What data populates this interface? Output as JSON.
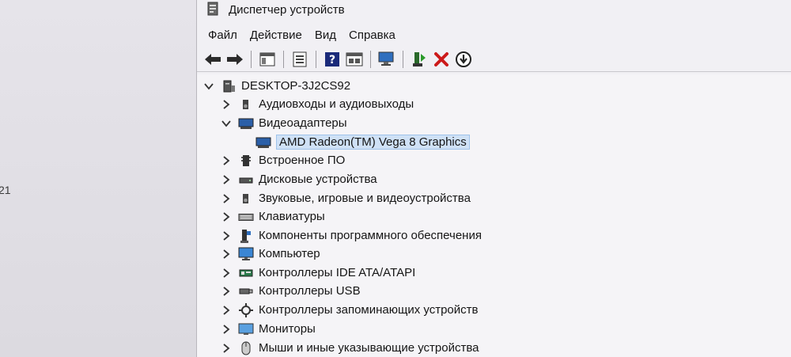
{
  "background_window": {
    "partial_text": "21"
  },
  "window": {
    "title": "Диспетчер устройств"
  },
  "menu": [
    {
      "label": "Файл"
    },
    {
      "label": "Действие"
    },
    {
      "label": "Вид"
    },
    {
      "label": "Справка"
    }
  ],
  "toolbar": {
    "icons": [
      "back-arrow-icon",
      "forward-arrow-icon",
      "show-hide-tree-icon",
      "properties-icon",
      "help-icon",
      "view-icon",
      "scan-hardware-icon",
      "update-driver-icon",
      "uninstall-icon",
      "disable-icon"
    ]
  },
  "tree": {
    "root": {
      "label": "DESKTOP-3J2CS92",
      "expanded": true
    },
    "items": [
      {
        "label": "Аудиовходы и аудиовыходы",
        "icon": "speaker-icon",
        "expanded": false
      },
      {
        "label": "Видеоадаптеры",
        "icon": "display-adapter-icon",
        "expanded": true
      },
      {
        "label": "AMD Radeon(TM) Vega 8 Graphics",
        "icon": "display-adapter-icon",
        "child": true,
        "selected": true
      },
      {
        "label": "Встроенное ПО",
        "icon": "firmware-icon",
        "expanded": false
      },
      {
        "label": "Дисковые устройства",
        "icon": "disk-drive-icon",
        "expanded": false
      },
      {
        "label": "Звуковые, игровые и видеоустройства",
        "icon": "speaker-icon",
        "expanded": false
      },
      {
        "label": "Клавиатуры",
        "icon": "keyboard-icon",
        "expanded": false
      },
      {
        "label": "Компоненты программного обеспечения",
        "icon": "software-component-icon",
        "expanded": false
      },
      {
        "label": "Компьютер",
        "icon": "computer-icon",
        "expanded": false
      },
      {
        "label": "Контроллеры IDE ATA/ATAPI",
        "icon": "ide-controller-icon",
        "expanded": false
      },
      {
        "label": "Контроллеры USB",
        "icon": "usb-icon",
        "expanded": false
      },
      {
        "label": "Контроллеры запоминающих устройств",
        "icon": "storage-controller-icon",
        "expanded": false
      },
      {
        "label": "Мониторы",
        "icon": "monitor-icon",
        "expanded": false
      },
      {
        "label": "Мыши и иные указывающие устройства",
        "icon": "mouse-icon",
        "expanded": false
      }
    ]
  },
  "colors": {
    "selection_bg": "#cfe1f6",
    "uninstall_red": "#cc1a1a"
  }
}
